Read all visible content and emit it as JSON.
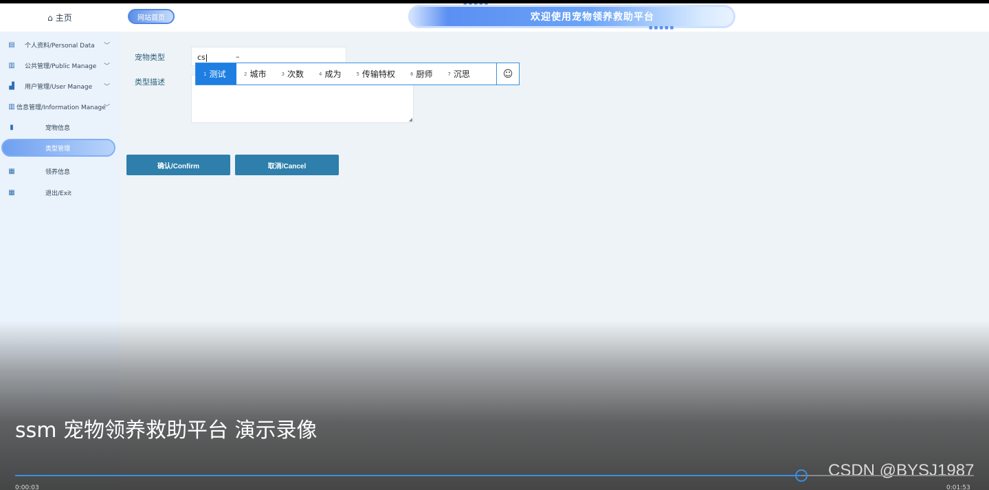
{
  "header": {
    "home_label": "主页",
    "site_home_label": "网站首页",
    "banner_title": "欢迎使用宠物领养救助平台"
  },
  "sidebar": {
    "items": [
      {
        "label": "个人资料/Personal Data",
        "icon": "document-icon",
        "expandable": true
      },
      {
        "label": "公共管理/Public Manage",
        "icon": "document-lock-icon",
        "expandable": true
      },
      {
        "label": "用户管理/User Manage",
        "icon": "building-icon",
        "expandable": true
      },
      {
        "label": "信息管理/Information Manage",
        "icon": "bar-chart-icon",
        "expandable": true
      },
      {
        "label": "宠物信息",
        "icon": "bookmark-icon",
        "expandable": false
      },
      {
        "label": "类型管理",
        "icon": "",
        "expandable": false,
        "active": true
      },
      {
        "label": "领养信息",
        "icon": "calendar-icon",
        "expandable": false
      },
      {
        "label": "退出/Exit",
        "icon": "calendar-check-icon",
        "expandable": false
      }
    ]
  },
  "form": {
    "type_label": "宠物类型",
    "type_value": "cs",
    "type_extra": "–",
    "desc_label": "类型描述",
    "confirm_label": "确认/Confirm",
    "cancel_label": "取消/Cancel"
  },
  "ime": {
    "candidates": [
      {
        "n": "1",
        "text": "测试"
      },
      {
        "n": "2",
        "text": "城市"
      },
      {
        "n": "3",
        "text": "次数"
      },
      {
        "n": "4",
        "text": "成为"
      },
      {
        "n": "5",
        "text": "传输特权"
      },
      {
        "n": "6",
        "text": "厨师"
      },
      {
        "n": "7",
        "text": "沉思"
      }
    ],
    "emoji": "☺"
  },
  "video": {
    "caption": "ssm 宠物领养救助平台 演示录像",
    "time_current": "0:00:03",
    "time_total": "0:01:53",
    "progress": 0.82,
    "watermark": "CSDN @BYSJ1987",
    "accent": "#3a8fe0"
  }
}
